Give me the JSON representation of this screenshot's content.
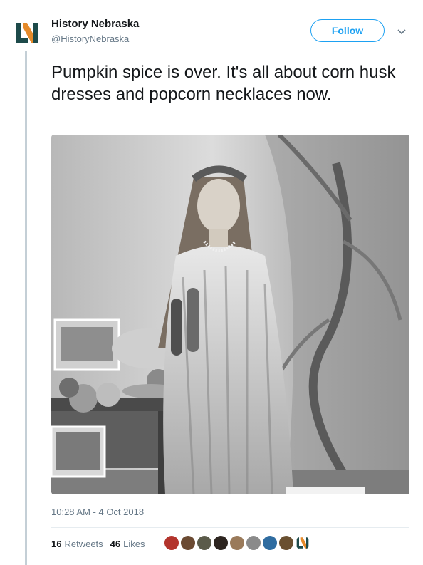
{
  "account": {
    "name": "History Nebraska",
    "handle": "@HistoryNebraska",
    "logo_icon": "history-nebraska-logo-icon",
    "brand_colors": {
      "dark": "#1d4a4a",
      "accent": "#e58a2a"
    }
  },
  "follow": {
    "label": "Follow",
    "color": "#1da1f2"
  },
  "tweet": {
    "text": "Pumpkin spice is over. It's all about corn husk dresses and popcorn necklaces now.",
    "timestamp": "10:28 AM - 4 Oct 2018"
  },
  "photo": {
    "icon": "vintage-photo-woman-corn-husk-dress-image",
    "description_tone": "black-and-white"
  },
  "stats": {
    "retweets_count": "16",
    "retweets_label": "Retweets",
    "likes_count": "46",
    "likes_label": "Likes"
  },
  "likers": [
    {
      "icon": "liker-avatar-1",
      "color": "#b3342c"
    },
    {
      "icon": "liker-avatar-2",
      "color": "#6b4a32"
    },
    {
      "icon": "liker-avatar-3",
      "color": "#5b5b4a"
    },
    {
      "icon": "liker-avatar-4",
      "color": "#2d2520"
    },
    {
      "icon": "liker-avatar-5",
      "color": "#9a7a5a"
    },
    {
      "icon": "liker-avatar-6",
      "color": "#8a8a8a"
    },
    {
      "icon": "liker-avatar-7",
      "color": "#2f6ca0"
    },
    {
      "icon": "liker-avatar-8",
      "color": "#6a5030"
    },
    {
      "icon": "liker-avatar-9",
      "color": "#1d4a4a"
    }
  ]
}
